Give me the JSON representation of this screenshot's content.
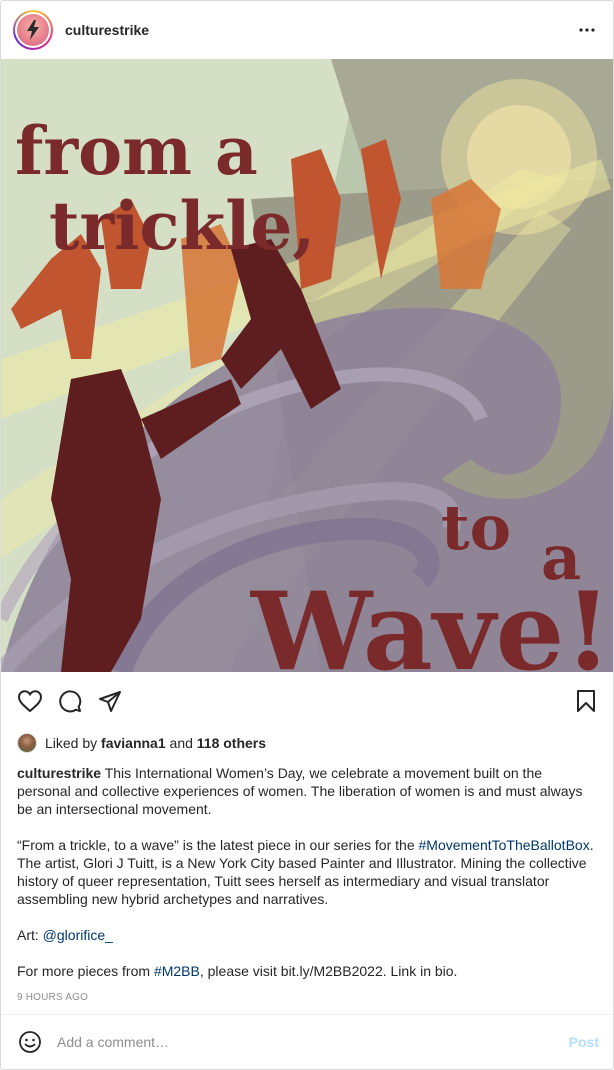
{
  "header": {
    "username": "culturestrike",
    "more_icon": "more-horizontal-icon"
  },
  "artwork": {
    "line1": "from a",
    "line2": "trickle,",
    "line3": "to",
    "line4": "a",
    "line5": "Wave!"
  },
  "actions": {
    "like_icon": "heart-icon",
    "comment_icon": "comment-icon",
    "share_icon": "share-icon",
    "save_icon": "bookmark-icon"
  },
  "likes": {
    "prefix": "Liked by",
    "user": "favianna1",
    "joiner": "and",
    "others": "118 others"
  },
  "caption": {
    "username": "culturestrike",
    "p1_text": "This International Women’s Day, we celebrate a movement built on the personal and collective experiences of women. The liberation of women is and must always be an intersectional movement.",
    "p2_start": "“From a trickle, to a wave” is the latest piece in our series for the",
    "p2_hashtag": "#MovementToTheBallotBox",
    "p2_end": ". The artist, Glori J Tuitt, is a New York City based Painter and Illustrator. Mining the collective history of queer representation, Tuitt sees herself as intermediary and visual translator assembling new hybrid archetypes and narratives.",
    "p3_label": "Art:",
    "p3_handle": "@glorifice_",
    "p4_start": "For more pieces from",
    "p4_hashtag": "#M2BB",
    "p4_end": ", please visit  bit.ly/M2BB2022. Link in bio."
  },
  "timestamp": "9 HOURS AGO",
  "comment": {
    "placeholder": "Add a comment…",
    "post_label": "Post",
    "emoji_icon": "emoji-icon"
  }
}
